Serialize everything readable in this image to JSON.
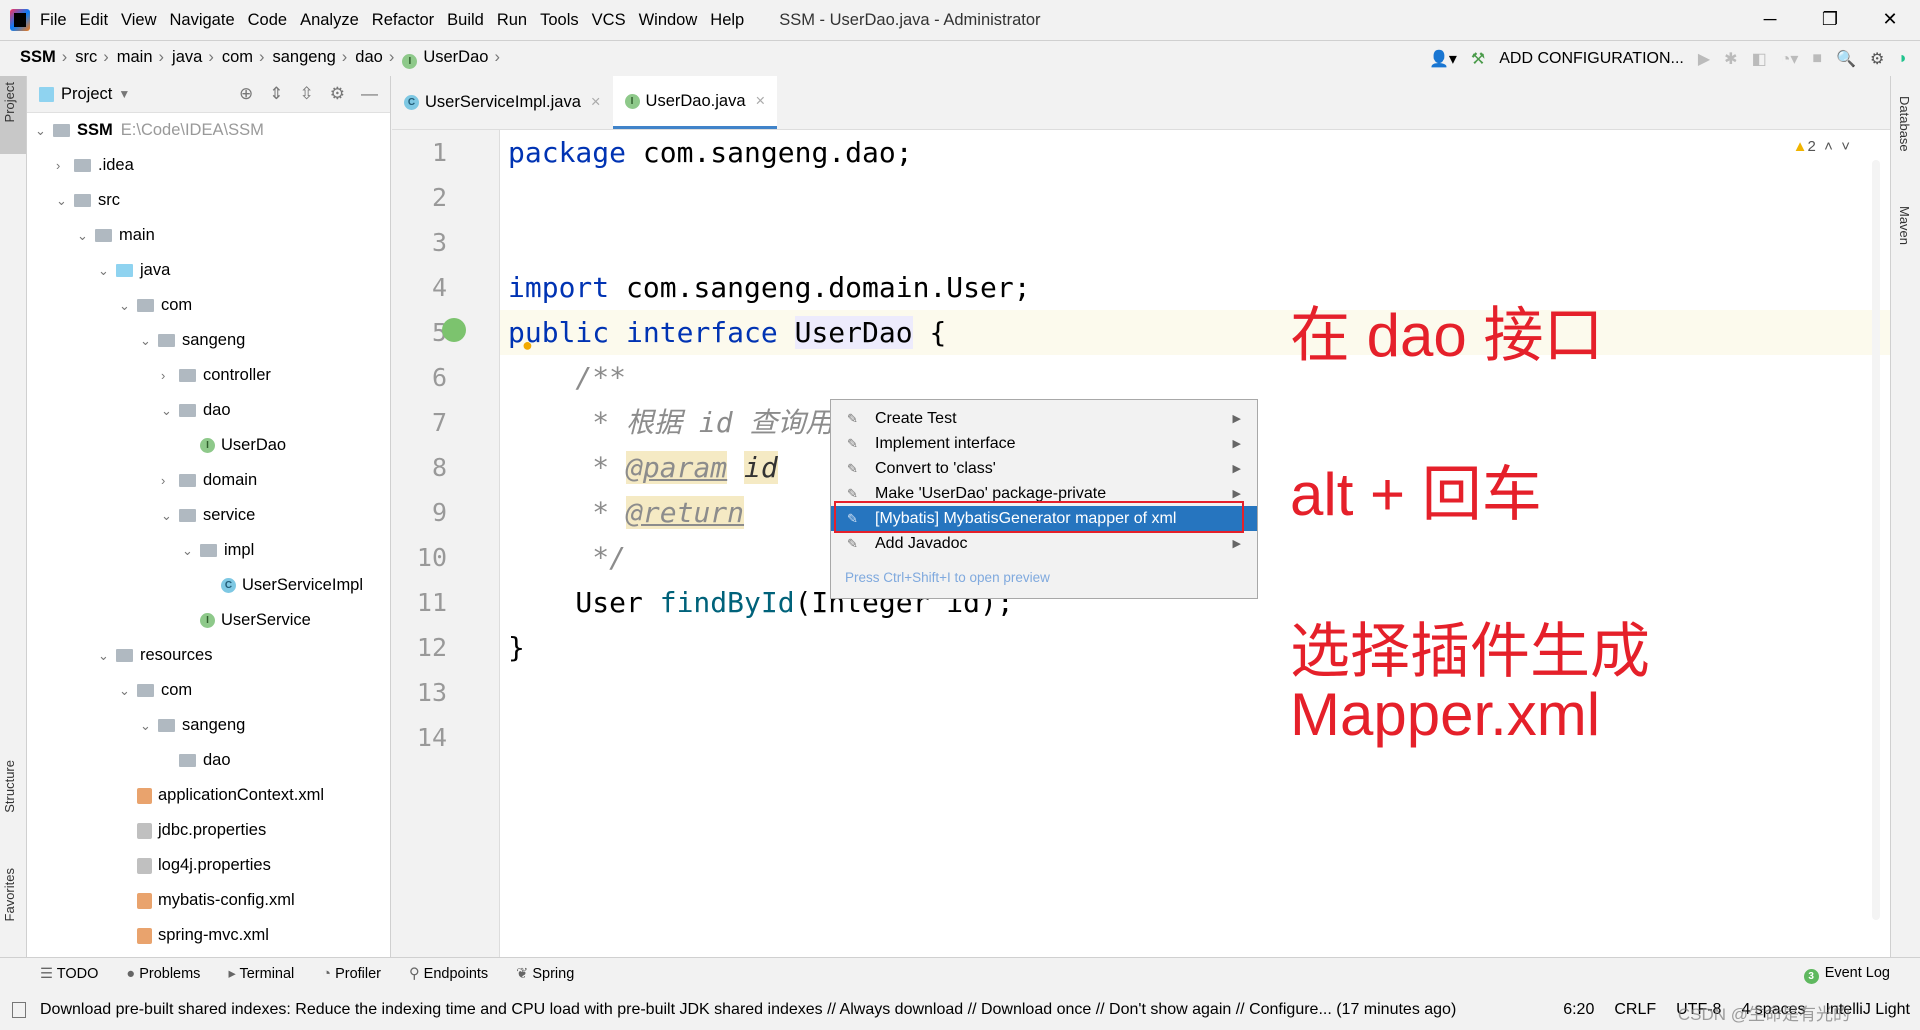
{
  "titlebar": {
    "menu": [
      "File",
      "Edit",
      "View",
      "Navigate",
      "Code",
      "Analyze",
      "Refactor",
      "Build",
      "Run",
      "Tools",
      "VCS",
      "Window",
      "Help"
    ],
    "title": "SSM - UserDao.java - Administrator"
  },
  "breadcrumb": [
    "SSM",
    "src",
    "main",
    "java",
    "com",
    "sangeng",
    "dao",
    "UserDao"
  ],
  "toolbar": {
    "add_config": "ADD CONFIGURATION..."
  },
  "left_strip": {
    "project": "Project",
    "structure": "Structure",
    "favorites": "Favorites"
  },
  "right_strip": {
    "database": "Database",
    "maven": "Maven"
  },
  "project_panel": {
    "title": "Project",
    "tree": [
      {
        "label": "SSM",
        "hint": "E:\\Code\\IDEA\\SSM",
        "depth": 0,
        "arrow": "down",
        "icon": "module"
      },
      {
        "label": ".idea",
        "depth": 1,
        "arrow": "right",
        "icon": "folder"
      },
      {
        "label": "src",
        "depth": 1,
        "arrow": "down",
        "icon": "folder"
      },
      {
        "label": "main",
        "depth": 2,
        "arrow": "down",
        "icon": "folder"
      },
      {
        "label": "java",
        "depth": 3,
        "arrow": "down",
        "icon": "source-folder"
      },
      {
        "label": "com",
        "depth": 4,
        "arrow": "down",
        "icon": "package"
      },
      {
        "label": "sangeng",
        "depth": 5,
        "arrow": "down",
        "icon": "package"
      },
      {
        "label": "controller",
        "depth": 6,
        "arrow": "right",
        "icon": "package"
      },
      {
        "label": "dao",
        "depth": 6,
        "arrow": "down",
        "icon": "package"
      },
      {
        "label": "UserDao",
        "depth": 7,
        "arrow": "",
        "icon": "interface"
      },
      {
        "label": "domain",
        "depth": 6,
        "arrow": "right",
        "icon": "package"
      },
      {
        "label": "service",
        "depth": 6,
        "arrow": "down",
        "icon": "package"
      },
      {
        "label": "impl",
        "depth": 7,
        "arrow": "down",
        "icon": "package"
      },
      {
        "label": "UserServiceImpl",
        "depth": 8,
        "arrow": "",
        "icon": "class"
      },
      {
        "label": "UserService",
        "depth": 7,
        "arrow": "",
        "icon": "interface"
      },
      {
        "label": "resources",
        "depth": 3,
        "arrow": "down",
        "icon": "folder"
      },
      {
        "label": "com",
        "depth": 4,
        "arrow": "down",
        "icon": "folder"
      },
      {
        "label": "sangeng",
        "depth": 5,
        "arrow": "down",
        "icon": "folder"
      },
      {
        "label": "dao",
        "depth": 6,
        "arrow": "",
        "icon": "folder"
      },
      {
        "label": "applicationContext.xml",
        "depth": 4,
        "arrow": "",
        "icon": "xml"
      },
      {
        "label": "jdbc.properties",
        "depth": 4,
        "arrow": "",
        "icon": "properties"
      },
      {
        "label": "log4j.properties",
        "depth": 4,
        "arrow": "",
        "icon": "properties"
      },
      {
        "label": "mybatis-config.xml",
        "depth": 4,
        "arrow": "",
        "icon": "xml"
      },
      {
        "label": "spring-mvc.xml",
        "depth": 4,
        "arrow": "",
        "icon": "xml"
      }
    ]
  },
  "tabs": [
    {
      "label": "UserServiceImpl.java",
      "icon": "class",
      "active": false
    },
    {
      "label": "UserDao.java",
      "icon": "interface",
      "active": true
    }
  ],
  "editor": {
    "warnings": "2",
    "line_numbers": [
      "1",
      "2",
      "3",
      "4",
      "5",
      "6",
      "7",
      "8",
      "9",
      "10",
      "11",
      "12",
      "13",
      "14"
    ],
    "lines": {
      "l1a": "package",
      "l1b": " com.sangeng.dao;",
      "l4a": "import",
      "l4b": " com.sangeng.domain.User;",
      "l6a": "public",
      "l6b": "interface",
      "l6c": "UserDao",
      "l6d": " {",
      "l7": "    /**",
      "l8": "     * 根据 id 查询用",
      "l9a": "     * ",
      "l9b": "@param",
      "l9c": "id",
      "l10a": "     * ",
      "l10b": "@return",
      "l11": "     */",
      "l12a": "    User ",
      "l12b": "findById",
      "l12c": "(Integer id);",
      "l13": "}"
    }
  },
  "popup": {
    "items": [
      {
        "label": "Create Test"
      },
      {
        "label": "Implement interface"
      },
      {
        "label": "Convert to 'class'"
      },
      {
        "label": "Make 'UserDao' package-private"
      },
      {
        "label": "[Mybatis] MybatisGenerator mapper of xml",
        "selected": true
      },
      {
        "label": "Add Javadoc"
      }
    ],
    "footer": "Press Ctrl+Shift+I to open preview"
  },
  "annotations": [
    "在 dao 接口",
    "alt + 回车",
    "选择插件生成",
    "Mapper.xml"
  ],
  "bottom_tools": [
    "TODO",
    "Problems",
    "Terminal",
    "Profiler",
    "Endpoints",
    "Spring"
  ],
  "event_log": {
    "count": "3",
    "label": "Event Log"
  },
  "status": {
    "message": "Download pre-built shared indexes: Reduce the indexing time and CPU load with pre-built JDK shared indexes // Always download // Download once // Don't show again // Configure... (17 minutes ago)",
    "position": "6:20",
    "line_sep": "CRLF",
    "encoding": "UTF-8",
    "indent": "4 spaces",
    "theme": "IntelliJ Light"
  },
  "watermark": "CSDN @生命是有光的",
  "colors": {
    "accent": "#2675bf",
    "annotation": "#e5202a",
    "keyword": "#0033b3"
  }
}
